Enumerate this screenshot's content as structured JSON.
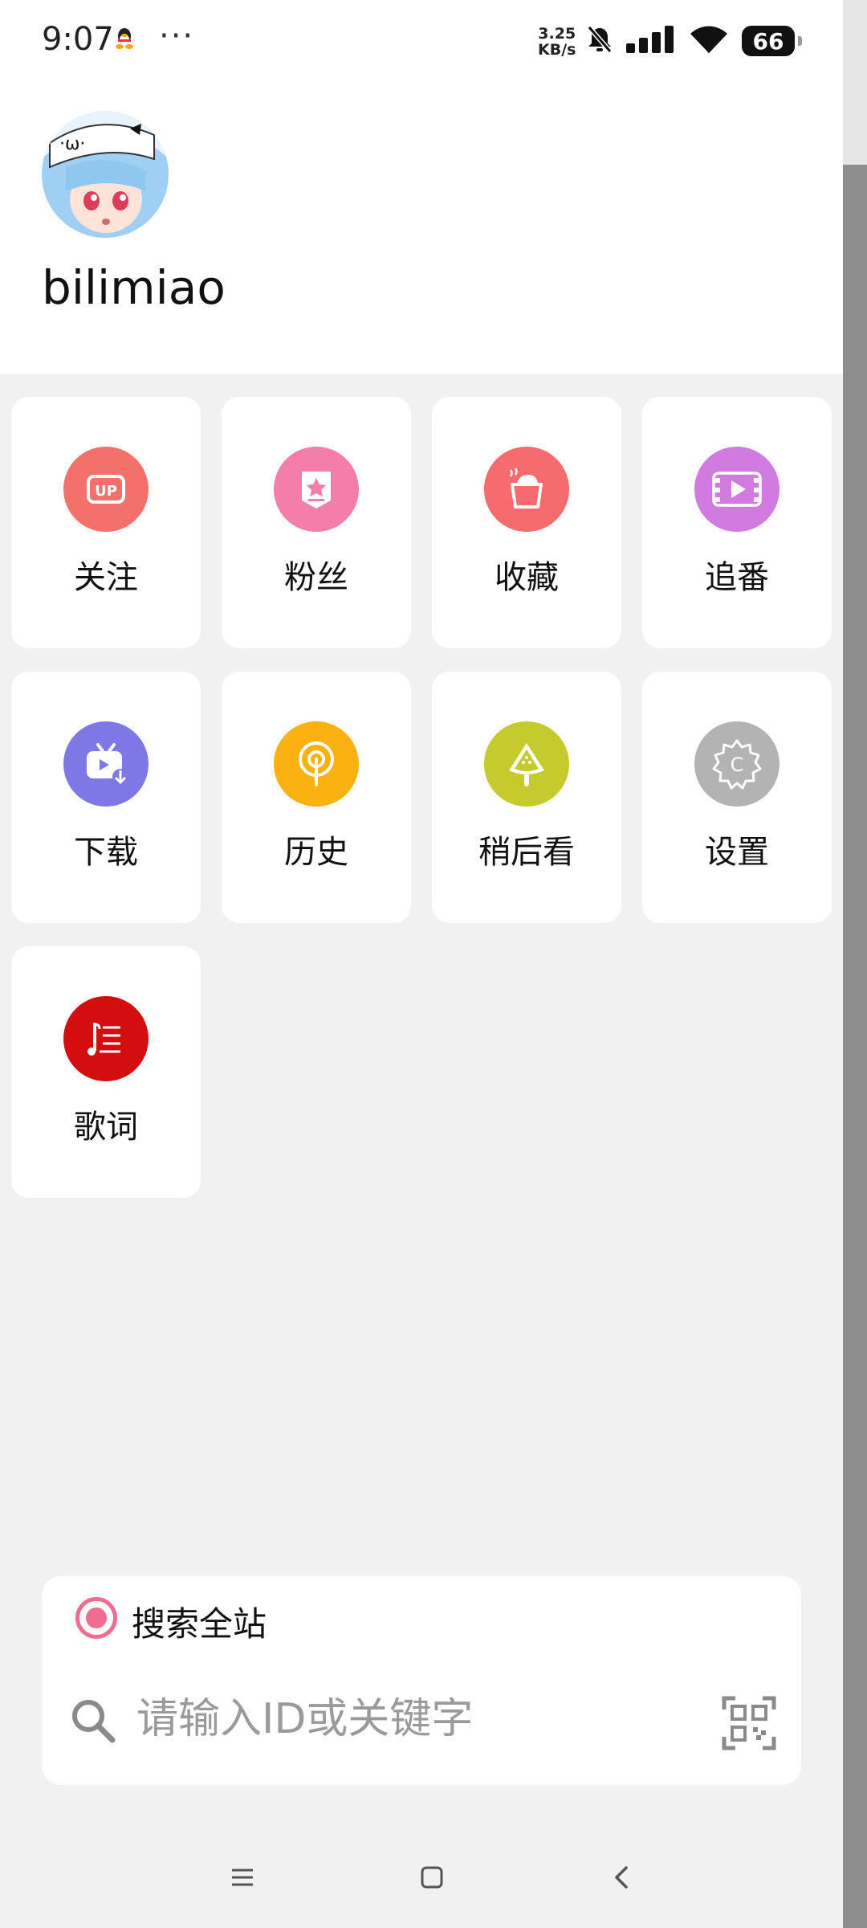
{
  "status_bar": {
    "time": "9:07",
    "more": "···",
    "net_speed_value": "3.25",
    "net_speed_unit": "KB/s",
    "battery": "66",
    "icons": [
      "qq-icon",
      "mute-bell-icon",
      "signal-icon",
      "wifi-icon",
      "battery-icon"
    ]
  },
  "profile": {
    "username": "bilimiao"
  },
  "menu": {
    "items": [
      {
        "label": "关注",
        "icon": "up-follow-icon",
        "color": "#f4706a"
      },
      {
        "label": "粉丝",
        "icon": "fans-badge-icon",
        "color": "#f57ea8"
      },
      {
        "label": "收藏",
        "icon": "favorite-cup-icon",
        "color": "#f66c6c"
      },
      {
        "label": "追番",
        "icon": "bangumi-film-icon",
        "color": "#d17be0"
      },
      {
        "label": "下载",
        "icon": "download-tv-icon",
        "color": "#7e78e6"
      },
      {
        "label": "历史",
        "icon": "history-lollipop-icon",
        "color": "#fbb10f"
      },
      {
        "label": "稍后看",
        "icon": "watch-later-watermelon-icon",
        "color": "#c5cb2c"
      },
      {
        "label": "设置",
        "icon": "settings-gear-icon",
        "color": "#b3b3b3"
      },
      {
        "label": "歌词",
        "icon": "lyrics-icon",
        "color": "#d40e0e"
      }
    ]
  },
  "search": {
    "scope_label": "搜索全站",
    "placeholder": "请输入ID或关键字"
  },
  "nav": {
    "icons": [
      "menu-lines-icon",
      "home-square-icon",
      "back-chevron-icon"
    ]
  }
}
